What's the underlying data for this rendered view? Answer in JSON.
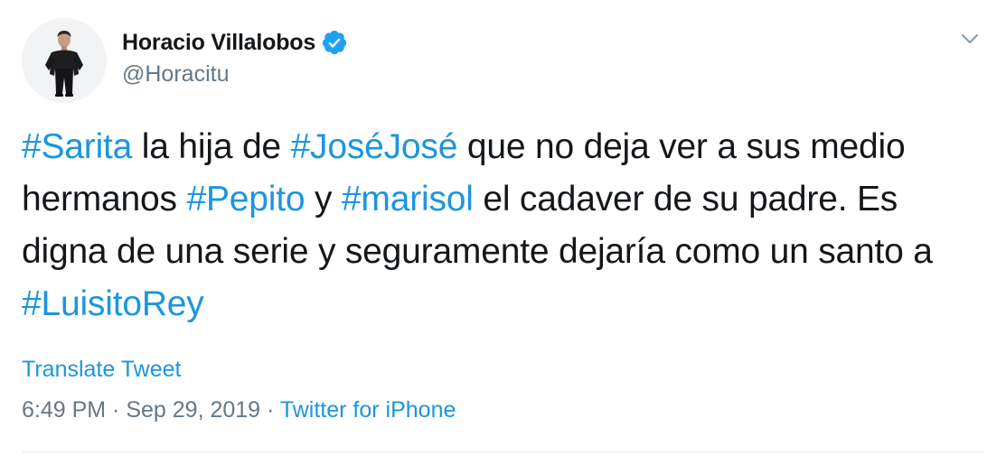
{
  "user": {
    "display_name": "Horacio Villalobos",
    "handle": "@Horacitu",
    "verified": true,
    "avatar_icon": "avatar-photo"
  },
  "tweet": {
    "segments": [
      {
        "text": "#Sarita",
        "type": "hashtag"
      },
      {
        "text": " la hija de ",
        "type": "text"
      },
      {
        "text": "#JoséJosé",
        "type": "hashtag"
      },
      {
        "text": " que no deja ver a sus medio hermanos ",
        "type": "text"
      },
      {
        "text": "#Pepito",
        "type": "hashtag"
      },
      {
        "text": " y ",
        "type": "text"
      },
      {
        "text": "#marisol",
        "type": "hashtag"
      },
      {
        "text": " el cadaver de su padre. Es digna de una serie y seguramente dejaría como un santo a ",
        "type": "text"
      },
      {
        "text": "#LuisitoRey",
        "type": "hashtag"
      }
    ],
    "translate_label": "Translate Tweet",
    "time": "6:49 PM",
    "separator": " · ",
    "date": "Sep 29, 2019",
    "source": "Twitter for iPhone"
  },
  "icons": {
    "verified": "verified-badge-icon",
    "menu": "chevron-down-icon"
  },
  "colors": {
    "link": "#1b95e0",
    "text": "#14171a",
    "muted": "#657786",
    "divider": "#e6ecf0"
  }
}
